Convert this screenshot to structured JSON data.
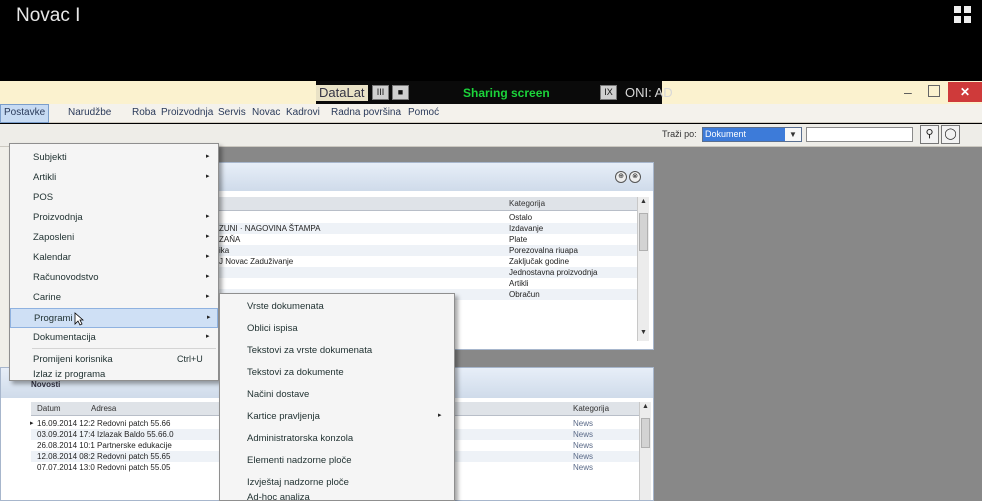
{
  "screen": {
    "title": "Novac I"
  },
  "window": {
    "datalat": "DataLat",
    "btn1": "III",
    "btn2": "■",
    "sharing": "Sharing screen",
    "btn3": "IX",
    "app_title": "ONI: AD",
    "minimize": "–",
    "close": "✕"
  },
  "menubar": {
    "items": [
      "Postavke",
      "Narudžbe",
      "Roba",
      "Proizvodnja",
      "Servis",
      "Novac",
      "Kadrovi",
      "Radna površina",
      "Pomoć"
    ]
  },
  "toolbar": {
    "search_label": "Traži po:",
    "search_select": "Dokument",
    "search_arrow": "▼",
    "search_button": "⚲",
    "extra_button": "◯"
  },
  "dropdown": {
    "items": [
      {
        "label": "Subjekti",
        "arrow": "▸"
      },
      {
        "label": "Artikli",
        "arrow": "▸"
      },
      {
        "label": "POS",
        "arrow": ""
      },
      {
        "label": "Proizvodnja",
        "arrow": "▸"
      },
      {
        "label": "Zaposleni",
        "arrow": "▸"
      },
      {
        "label": "Kalendar",
        "arrow": "▸"
      },
      {
        "label": "Računovodstvo",
        "arrow": "▸"
      },
      {
        "label": "Carine",
        "arrow": "▸"
      },
      {
        "label": "Programi",
        "arrow": "▸"
      },
      {
        "label": "Dokumentacija",
        "arrow": "▸"
      },
      {
        "label": "Promijeni korisnika",
        "shortcut": "Ctrl+U"
      },
      {
        "label": "Izlaz iz programa",
        "shortcut": ""
      }
    ]
  },
  "submenu": {
    "items": [
      {
        "label": "Vrste dokumenata",
        "arrow": ""
      },
      {
        "label": "Oblici ispisa",
        "arrow": ""
      },
      {
        "label": "Tekstovi za vrste dokumenata",
        "arrow": ""
      },
      {
        "label": "Tekstovi za dokumente",
        "arrow": ""
      },
      {
        "label": "Načini dostave",
        "arrow": ""
      },
      {
        "label": "Kartice pravljenja",
        "arrow": "▸"
      },
      {
        "label": "Administratorska konzola",
        "arrow": ""
      },
      {
        "label": "Elementi nadzorne ploče",
        "arrow": ""
      },
      {
        "label": "Izvještaj nadzorne ploče",
        "arrow": ""
      },
      {
        "label": "Ad-hoc analiza",
        "arrow": ""
      }
    ]
  },
  "panel1": {
    "ctrl1": "⊕",
    "ctrl2": "⊗",
    "column_category": "Kategorija",
    "rows": [
      {
        "text": "",
        "category": "Ostalo"
      },
      {
        "text": "ZUNI · NAGOVINA ŠTAMPA",
        "category": "Izdavanje"
      },
      {
        "text": "ZAŇA",
        "category": "Plate"
      },
      {
        "text": "ika",
        "category": "Porezovalna riuapa"
      },
      {
        "text": "J Novac Zaduživanje",
        "category": "Zaključak godine"
      },
      {
        "text": "",
        "category": "Jednostavna proizvodnja"
      },
      {
        "text": "",
        "category": "Artikli"
      },
      {
        "text": "",
        "category": "Obračun"
      }
    ]
  },
  "panel2": {
    "title": "Novosti",
    "col_date": "Datum",
    "col_addr": "Adresa",
    "col_category": "Kategorija",
    "rows": [
      {
        "text": "16.09.2014 12:2 Redovni patch 55.66",
        "category": "News"
      },
      {
        "text": "03.09.2014 17:4 Izlazak Baldo 55.66.0",
        "category": "News"
      },
      {
        "text": "26.08.2014 10:1 Partnerske edukacije",
        "category": "News"
      },
      {
        "text": "12.08.2014 08:2 Redovni patch 55.65",
        "category": "News"
      },
      {
        "text": "07.07.2014 13:0 Redovni patch 55.05",
        "category": "News"
      }
    ]
  }
}
